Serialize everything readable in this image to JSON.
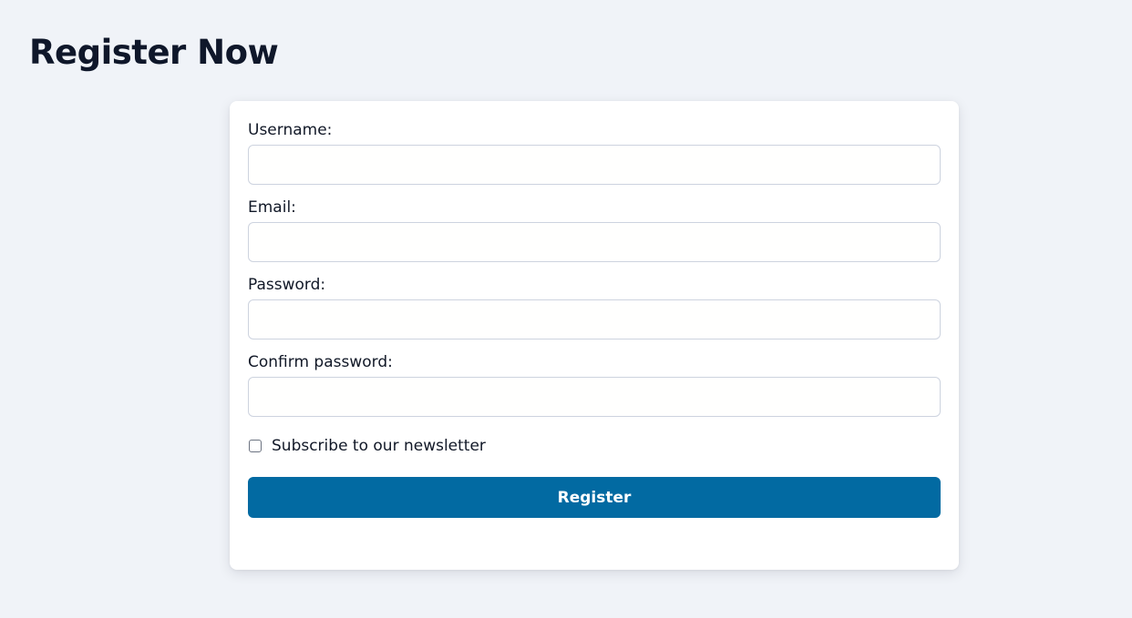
{
  "page": {
    "title": "Register Now"
  },
  "form": {
    "username": {
      "label": "Username:",
      "value": "",
      "placeholder": ""
    },
    "email": {
      "label": "Email:",
      "value": "",
      "placeholder": ""
    },
    "password": {
      "label": "Password:",
      "value": "",
      "placeholder": ""
    },
    "confirm_password": {
      "label": "Confirm password:",
      "value": "",
      "placeholder": ""
    },
    "newsletter": {
      "label": "Subscribe to our newsletter",
      "checked": false
    },
    "submit_label": "Register"
  },
  "colors": {
    "background": "#f0f3f8",
    "card": "#ffffff",
    "button": "#026aa2",
    "button_text": "#ffffff",
    "input_border": "#cdd3df",
    "text": "#111827"
  }
}
